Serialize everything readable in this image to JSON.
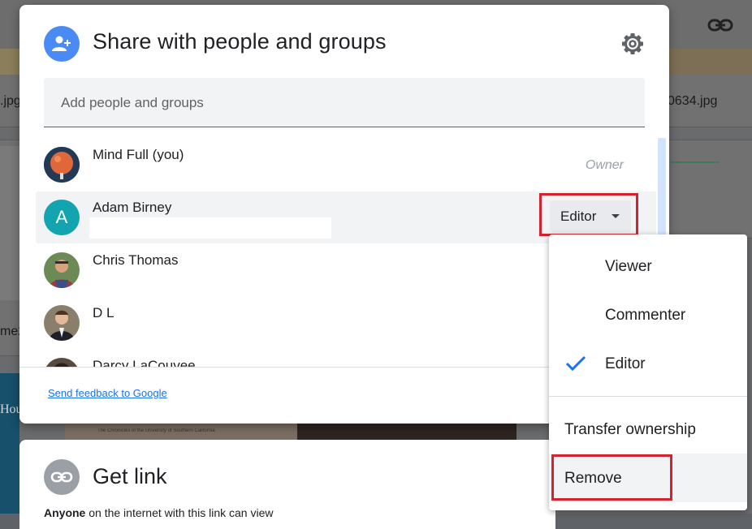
{
  "background": {
    "file_left_label": ".jpg",
    "file_right_label": "0634.jpg",
    "left_partial_a": "me2",
    "left_partial_b": "Hou",
    "thumb_caption": "The Chronicles of the University of Southern California"
  },
  "share_dialog": {
    "title": "Share with people and groups",
    "add_placeholder": "Add people and groups",
    "people": [
      {
        "name": "Mind Full (you)",
        "role": "Owner"
      },
      {
        "name": "Adam Birney",
        "avatar_letter": "A",
        "role": "Editor"
      },
      {
        "name": "Chris Thomas"
      },
      {
        "name": "D L"
      },
      {
        "name": "Darcy LaCouvee"
      }
    ],
    "feedback_link": "Send feedback to Google"
  },
  "role_menu": {
    "items": [
      "Viewer",
      "Commenter",
      "Editor"
    ],
    "selected": "Editor",
    "actions": [
      "Transfer ownership",
      "Remove"
    ]
  },
  "link_dialog": {
    "title": "Get link",
    "subtitle_bold": "Anyone",
    "subtitle_rest": " on the internet with this link can view"
  },
  "colors": {
    "accent_blue": "#1a73e8",
    "highlight_red": "#d3232f",
    "avatar_teal": "#12a4af"
  }
}
